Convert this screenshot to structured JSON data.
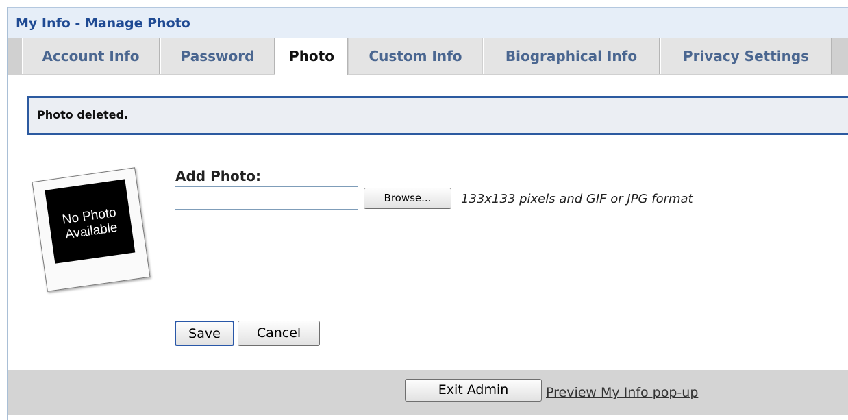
{
  "window": {
    "title": "My Info - Manage Photo"
  },
  "tabs": [
    {
      "label": "Account Info",
      "active": false
    },
    {
      "label": "Password",
      "active": false
    },
    {
      "label": "Photo",
      "active": true
    },
    {
      "label": "Custom Info",
      "active": false
    },
    {
      "label": "Biographical Info",
      "active": false
    },
    {
      "label": "Privacy Settings",
      "active": false
    }
  ],
  "message": {
    "text": "Photo deleted."
  },
  "photo": {
    "placeholder_line1": "No Photo",
    "placeholder_line2": "Available"
  },
  "add_photo": {
    "label": "Add Photo:",
    "file_value": "",
    "browse_label": "Browse...",
    "hint": "133x133 pixels and GIF or JPG format"
  },
  "actions": {
    "save_label": "Save",
    "cancel_label": "Cancel"
  },
  "footer": {
    "exit_label": "Exit Admin",
    "preview_label": "Preview My Info pop-up"
  },
  "colors": {
    "accent": "#2c5aa0",
    "title": "#1f4a93",
    "tab_text": "#4a6690"
  }
}
